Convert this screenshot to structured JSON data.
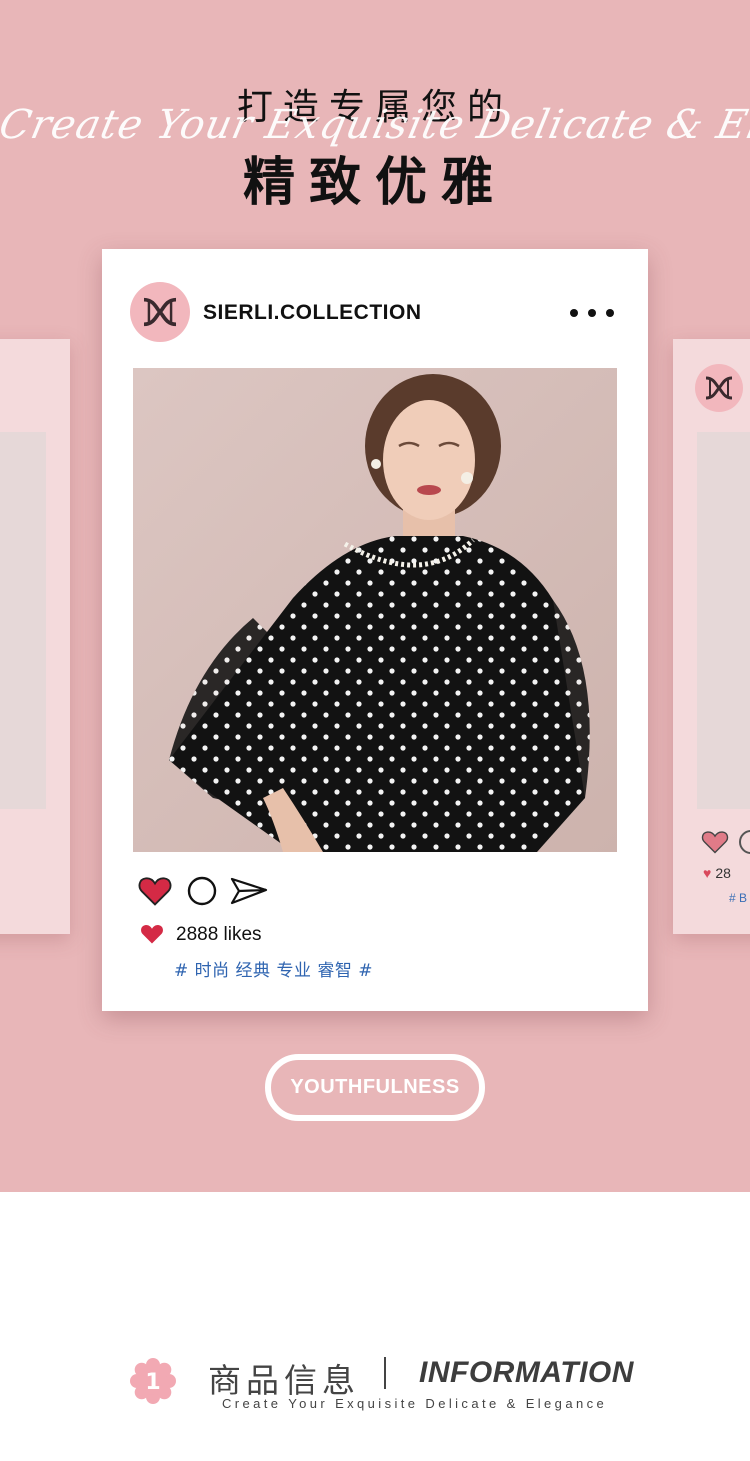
{
  "hero": {
    "headline_line1": "打造专属您的",
    "script_overlay": "Create Your Exquisite Delicate & Elegance",
    "headline_line2": "精致优雅"
  },
  "post": {
    "username": "SIERLI.COLLECTION",
    "more_icon": "more-dots-icon",
    "likes": "2888 likes",
    "tags": "# 时尚 经典 专业 睿智 #",
    "photo_description": "model in black polka-dot chiffon cape blouse"
  },
  "side_card_right": {
    "likes_partial": "28",
    "tag_partial": "# B"
  },
  "badge_button": {
    "label": "YOUTHFULNESS"
  },
  "info": {
    "badge_number": "1",
    "title_cn": "商品信息",
    "title_en": "INFORMATION",
    "subtitle": "Create Your Exquisite Delicate & Elegance"
  },
  "colors": {
    "hero_bg": "#e8b6b8",
    "heart_red": "#d42a45",
    "tag_blue": "#2f64b0",
    "avatar_pink": "#f2b7bd"
  }
}
